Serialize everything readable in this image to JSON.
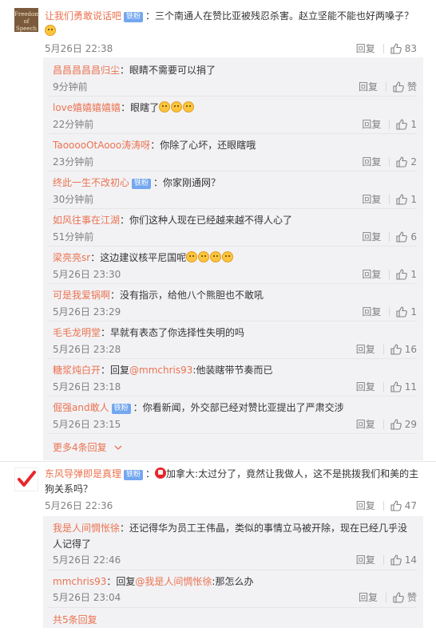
{
  "threads": [
    {
      "user": "让我们勇敢说话吧",
      "avatar_text": "Freedom of Speech",
      "badge": "铁粉",
      "text": "：三个南通人在赞比亚被残忍杀害。赵立坚能不能也好两嗓子？",
      "time": "5月26日 22:38",
      "reply_label": "回复",
      "likes": "83",
      "sub_replies": [
        {
          "user": "昌昌昌昌昌归尘",
          "text": "：眼睛不需要可以捐了",
          "time": "9分钟前",
          "likes": "赞"
        },
        {
          "user": "love嬉嬉嬉嬉嬉",
          "text": "：眼瞎了",
          "time": "22分钟前",
          "likes": "1"
        },
        {
          "user": "TaooooOtAooo涛涛呀",
          "text": "：你除了心坏，还眼瞎哦",
          "time": "23分钟前",
          "likes": "2"
        },
        {
          "user": "终此一生不改初心",
          "badge": "铁粉",
          "text": "：你家刚通网？",
          "time": "30分钟前",
          "likes": "1"
        },
        {
          "user": "如风往事在江湖",
          "text": "：你们这种人现在已经越来越不得人心了",
          "time": "51分钟前",
          "likes": "6"
        },
        {
          "user": "梁亮亮sr",
          "text": "：这边建议核平尼国呢",
          "time": "5月26日 23:30",
          "likes": "1"
        },
        {
          "user": "可是我爱锅啊",
          "text": "：没有指示，给他八个熊胆也不敢吼",
          "time": "5月26日 23:29",
          "likes": "1"
        },
        {
          "user": "毛毛龙明堂",
          "text": "：早就有表态了你选择性失明的吗",
          "time": "5月26日 23:28",
          "likes": "16"
        },
        {
          "user": "糖浆炖白开",
          "text": "：回复",
          "mention": "@mmchris93",
          "text2": ":他装瞎带节奏而已",
          "time": "5月26日 23:18",
          "likes": "11"
        },
        {
          "user": "倔强and敢人",
          "badge": "铁粉",
          "text": "：你看新闻，外交部已经对赞比亚提出了严肃交涉",
          "time": "5月26日 23:15",
          "likes": "29"
        }
      ],
      "more_label": "更多4条回复"
    },
    {
      "user": "东风导弹即是真理",
      "badge": "铁粉",
      "text": "加拿大:太过分了，竟然让我做人，这不是挑拨我们和美的主",
      "text_line2": "狗关系吗？",
      "time": "5月26日 22:36",
      "reply_label": "回复",
      "likes": "47",
      "sub_replies": [
        {
          "user": "我是人间惆怅徐",
          "text": "：还记得华为员工王伟晶，类似的事情立马被开除，现在已经几乎没",
          "text_line2": "人记得了",
          "time": "5月26日 22:46",
          "likes": "14"
        },
        {
          "user": "mmchris93",
          "text": "：回复",
          "mention": "@我是人间惆怅徐",
          "text2": ":那怎么办",
          "time": "5月26日 23:04",
          "likes": "赞"
        }
      ],
      "more_label": "共5条回复"
    }
  ],
  "colors": {
    "name": "#eb7350",
    "badge": "#73a7ef",
    "subbox_bg": "#f2f2f5",
    "muted": "#808080"
  }
}
